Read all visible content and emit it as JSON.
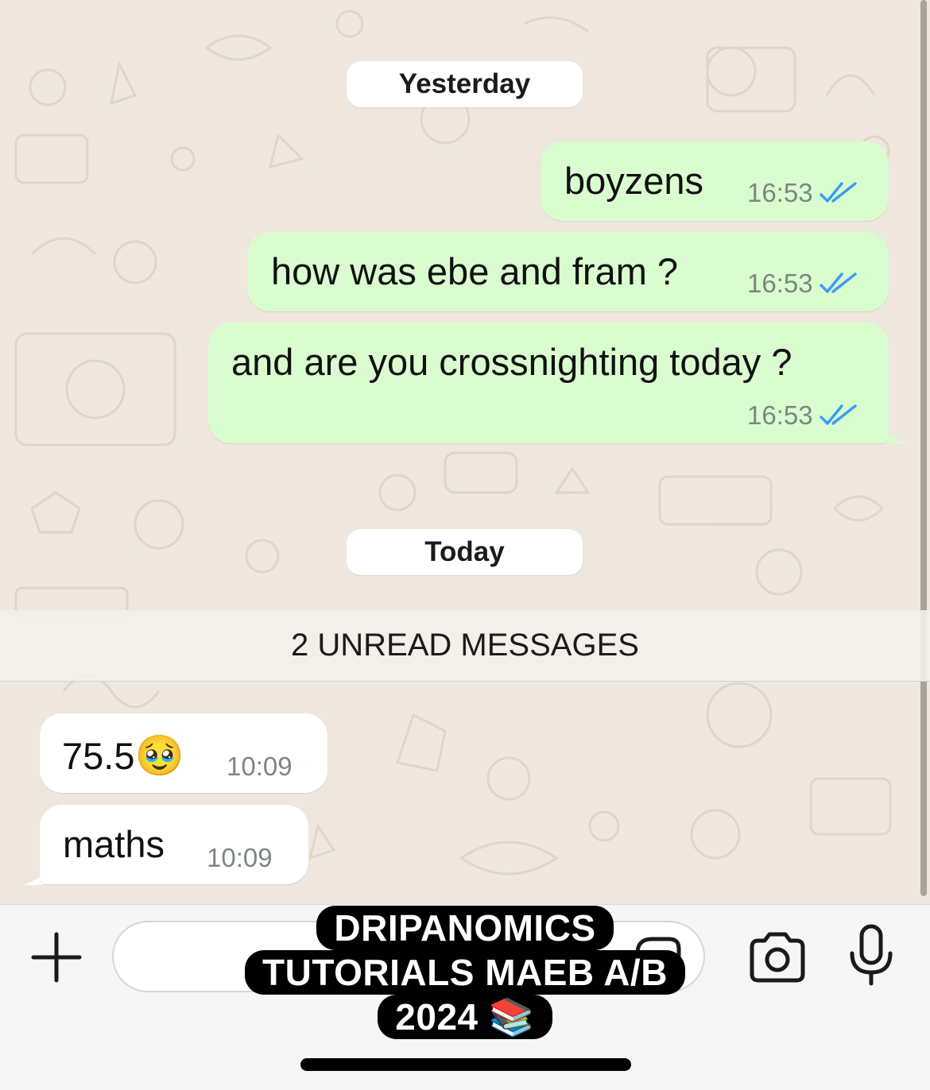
{
  "chat": {
    "date_yesterday": "Yesterday",
    "date_today": "Today",
    "unread_banner": "2 UNREAD MESSAGES",
    "outgoing": [
      {
        "text": "boyzens",
        "time": "16:53",
        "status": "read"
      },
      {
        "text": "how was ebe and fram ?",
        "time": "16:53",
        "status": "read"
      },
      {
        "text": "and are you crossnighting today ?",
        "time": "16:53",
        "status": "read"
      }
    ],
    "incoming": [
      {
        "text": "75.5",
        "emoji": "🥹",
        "time": "10:09"
      },
      {
        "text": "maths",
        "time": "10:09"
      }
    ]
  },
  "input_bar": {
    "plus_icon": "plus-icon",
    "text_placeholder": "",
    "sticker_icon": "sticker-icon",
    "camera_icon": "camera-icon",
    "mic_icon": "microphone-icon"
  },
  "watermark": {
    "line1": "DRIPANOMICS",
    "line2": "TUTORIALS MAEB A/B",
    "line3": "2024 📚"
  },
  "colors": {
    "outgoing_bubble": "#dafdd0",
    "incoming_bubble": "#ffffff",
    "read_ticks": "#3a9df5",
    "chat_background": "#efe7dd"
  }
}
